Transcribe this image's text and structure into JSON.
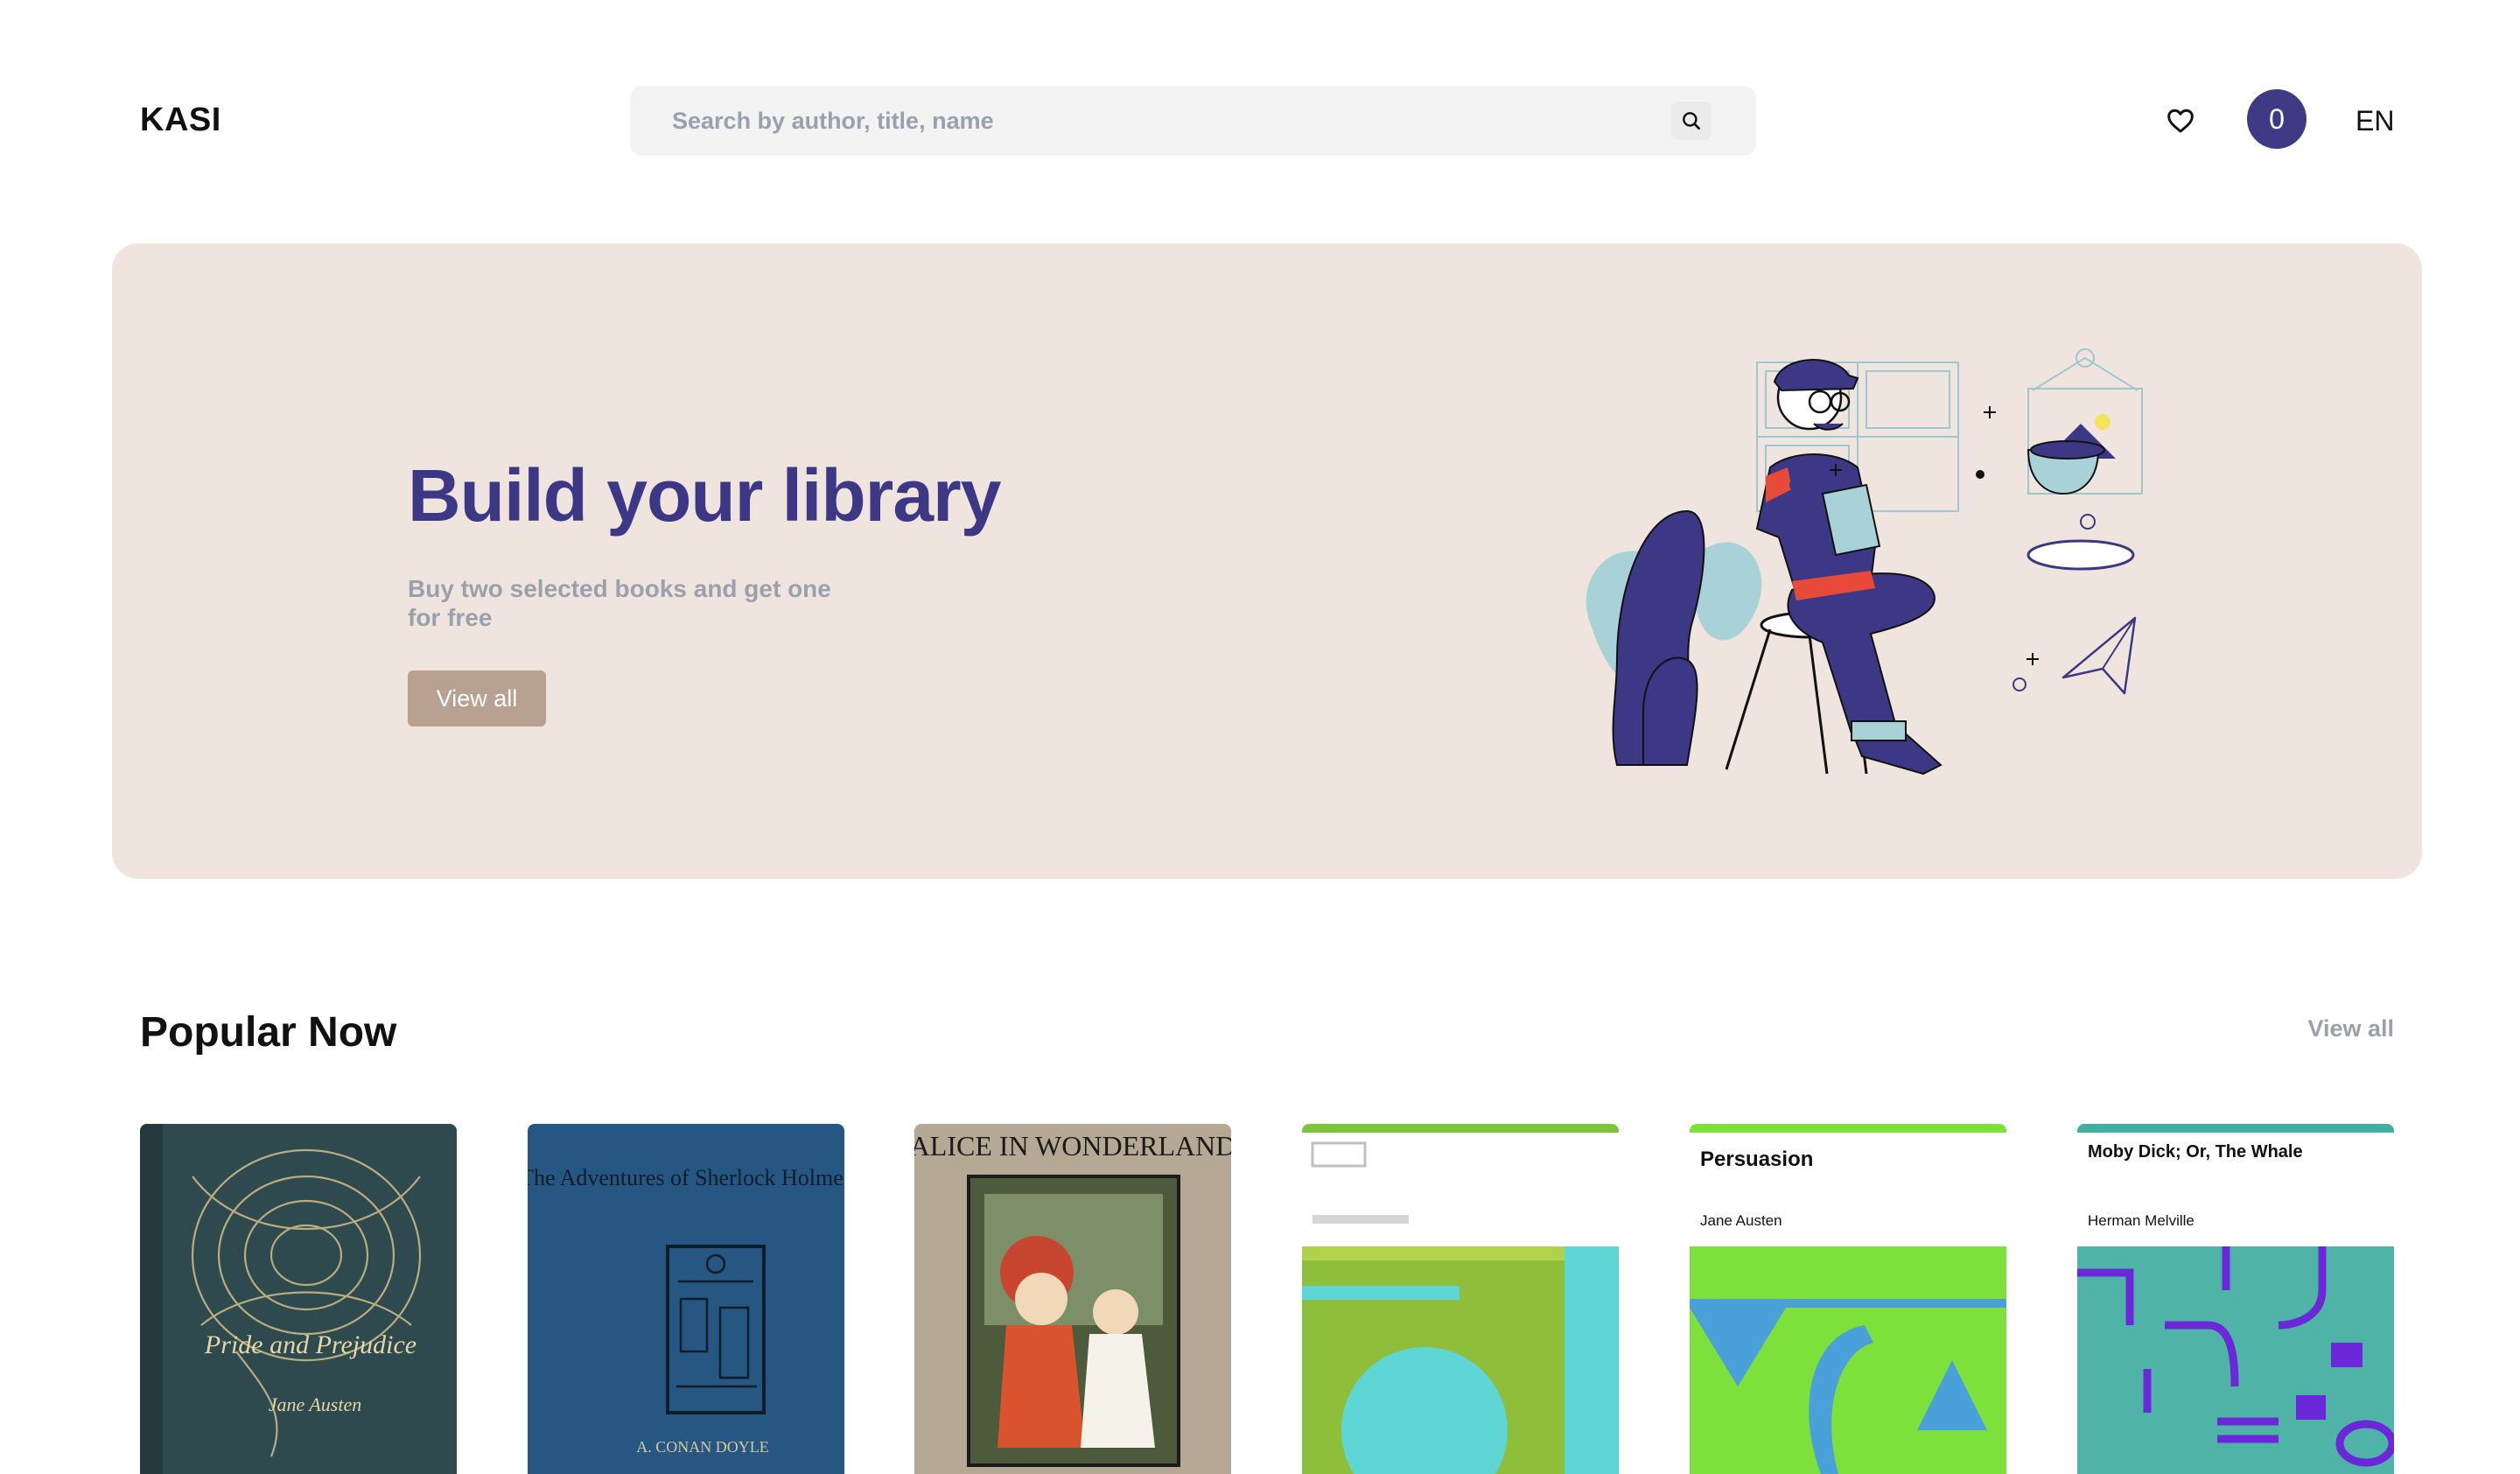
{
  "header": {
    "logo": "KASI",
    "search_placeholder": "Search by author, title, name",
    "search_icon": "search-icon",
    "wishlist_icon": "heart-icon",
    "cart_count": "0",
    "language": "EN"
  },
  "hero": {
    "title": "Build your library",
    "subtitle": "Buy two selected books and get one for free",
    "button_label": "View all",
    "accent_color": "#3d3885",
    "background_color": "#f0e5de",
    "button_color": "#b8a191"
  },
  "popular": {
    "title": "Popular Now",
    "view_all": "View all",
    "books": [
      {
        "cover_title": "Pride and Prejudice",
        "cover_author": "Jane Austen"
      },
      {
        "cover_title": "The Adventures of Sherlock Holmes",
        "cover_author": "A. CONAN DOYLE"
      },
      {
        "cover_title": "ALICE IN WONDERLAND",
        "cover_author": ""
      },
      {
        "cover_title": "",
        "cover_author": ""
      },
      {
        "cover_title": "Persuasion",
        "cover_author": "Jane Austen"
      },
      {
        "cover_title": "Moby Dick; Or, The Whale",
        "cover_author": "Herman Melville"
      }
    ]
  }
}
